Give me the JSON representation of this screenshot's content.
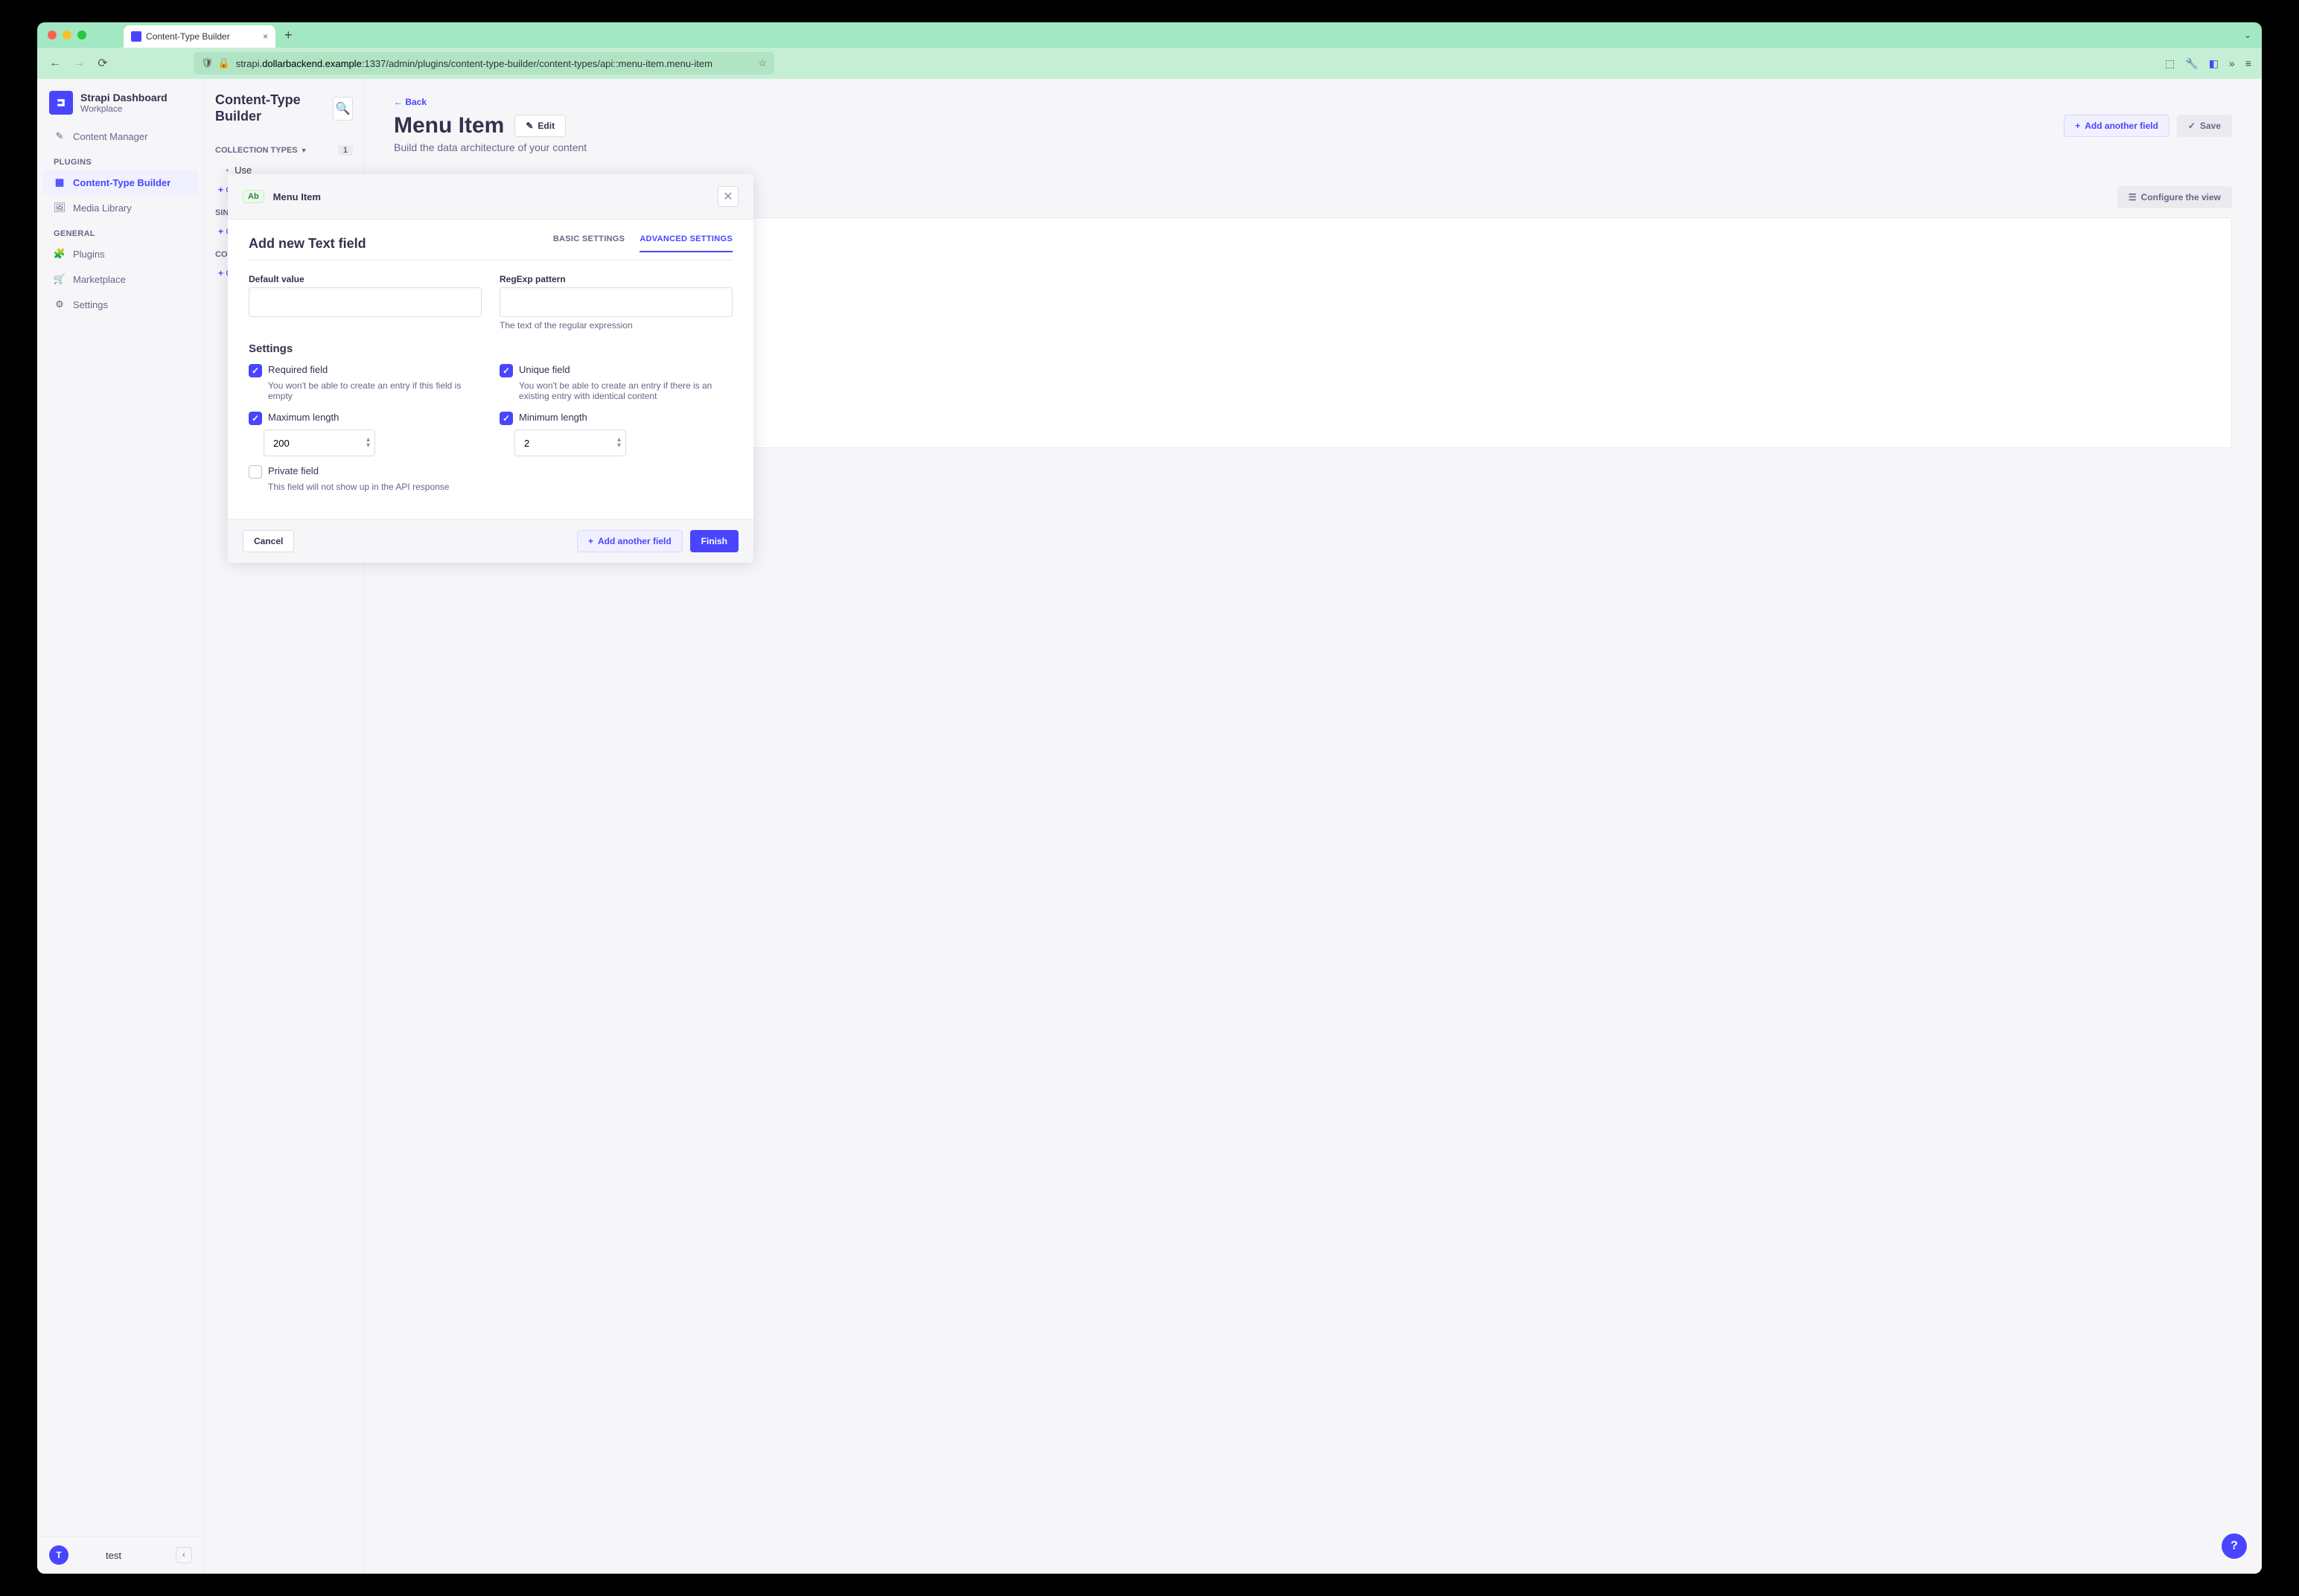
{
  "browser": {
    "tab_title": "Content-Type Builder",
    "url_prefix": "strapi.",
    "url_domain": "dollarbackend.example",
    "url_rest": ":1337/admin/plugins/content-type-builder/content-types/api::menu-item.menu-item"
  },
  "sidebar": {
    "title": "Strapi Dashboard",
    "subtitle": "Workplace",
    "items": {
      "content_manager": "Content Manager",
      "plugins_section": "PLUGINS",
      "ctb": "Content-Type Builder",
      "media": "Media Library",
      "general_section": "GENERAL",
      "plugins": "Plugins",
      "marketplace": "Marketplace",
      "settings": "Settings"
    },
    "user_initial": "T",
    "user_name": "test"
  },
  "col2": {
    "title": "Content-Type Builder",
    "collection_types": "COLLECTION TYPES",
    "collection_count": "1",
    "collection_item": "Use",
    "create_collection": "Crea",
    "single_types": "SINGLE T",
    "create_single": "Crea",
    "components": "COMPONE",
    "create_component": "Crea"
  },
  "page": {
    "back": "Back",
    "title": "Menu Item",
    "subtitle": "Build the data architecture of your content",
    "edit": "Edit",
    "add_field": "Add another field",
    "save": "Save",
    "configure": "Configure the view"
  },
  "modal": {
    "badge": "Ab",
    "head_title": "Menu Item",
    "title": "Add new Text field",
    "tab_basic": "BASIC SETTINGS",
    "tab_advanced": "ADVANCED SETTINGS",
    "default_label": "Default value",
    "regexp_label": "RegExp pattern",
    "regexp_hint": "The text of the regular expression",
    "settings_title": "Settings",
    "required_label": "Required field",
    "required_hint": "You won't be able to create an entry if this field is empty",
    "unique_label": "Unique field",
    "unique_hint": "You won't be able to create an entry if there is an existing entry with identical content",
    "max_label": "Maximum length",
    "max_value": "200",
    "min_label": "Minimum length",
    "min_value": "2",
    "private_label": "Private field",
    "private_hint": "This field will not show up in the API response",
    "cancel": "Cancel",
    "add_another": "Add another field",
    "finish": "Finish"
  },
  "help": "?"
}
